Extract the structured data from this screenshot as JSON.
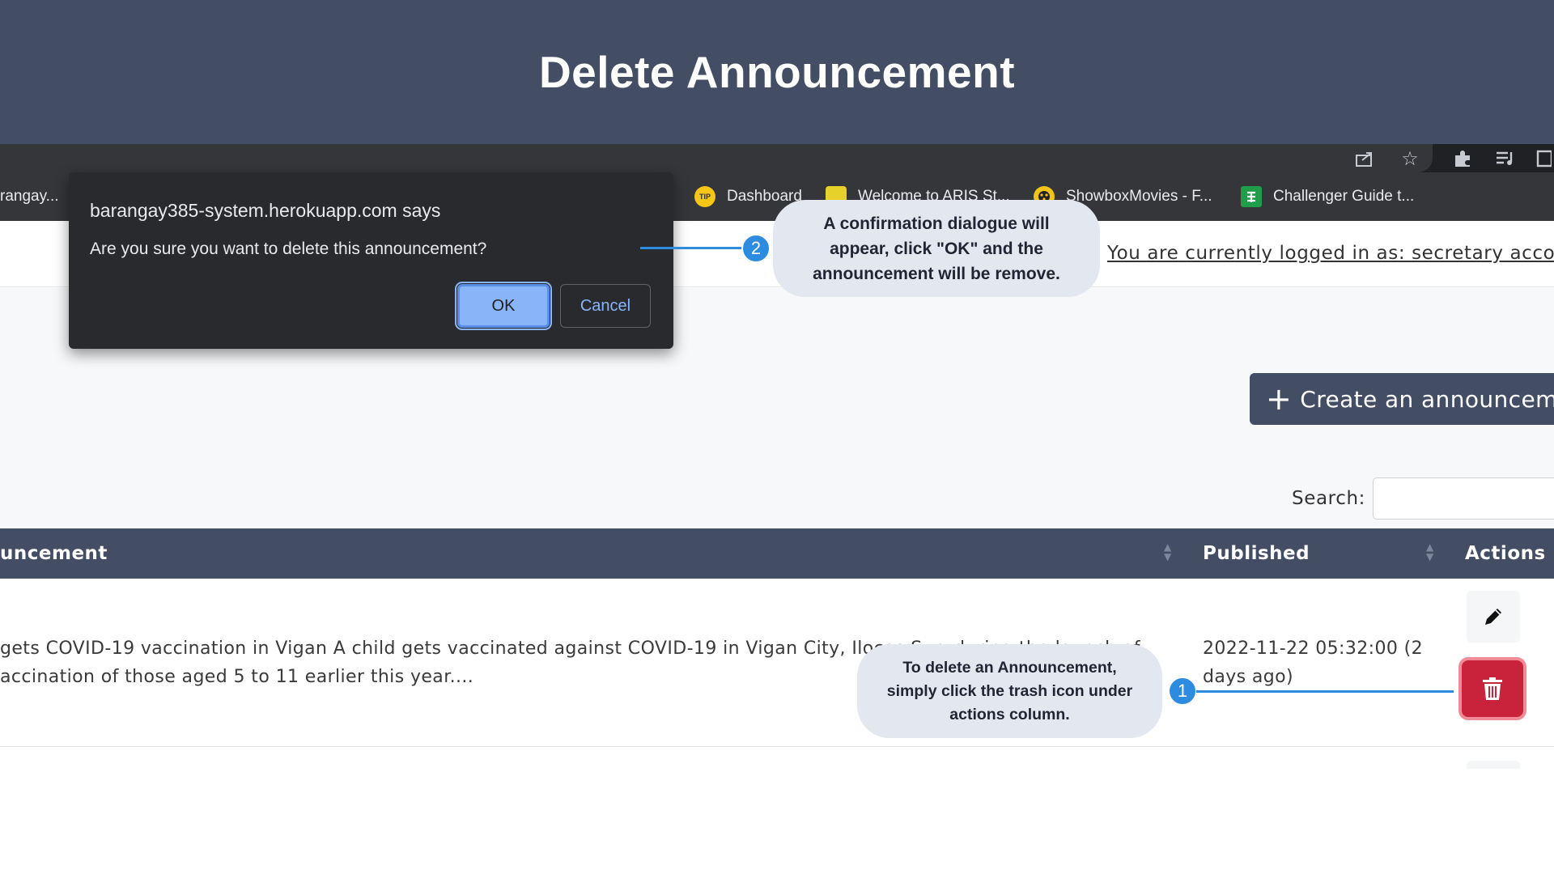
{
  "banner": {
    "title": "Delete Announcement"
  },
  "bookmarks": {
    "items": [
      {
        "label": "rangay...",
        "icon": "bookmark-icon"
      },
      {
        "label": "Dashboard",
        "icon": "tip-icon",
        "icon_text": "TIP"
      },
      {
        "label": "Welcome to ARIS St...",
        "icon": "aris-icon"
      },
      {
        "label": "ShowboxMovies - F...",
        "icon": "showbox-icon"
      },
      {
        "label": "Challenger Guide t...",
        "icon": "sheets-icon"
      }
    ]
  },
  "app": {
    "logged_in": "You are currently logged in as: secretary account",
    "create_button": "Create an announcement",
    "search_label": "Search:"
  },
  "table": {
    "headers": [
      "uncement",
      "Published",
      "Actions"
    ],
    "row": {
      "announcement_line1": " gets COVID-19 vaccination in Vigan A child gets vaccinated against COVID-19 in Vigan City, Ilocos Sur, during the launch of",
      "announcement_line2": "accination of those aged 5 to 11 earlier this year....",
      "published_line1": "2022-11-22 05:32:00 (2",
      "published_line2": "days ago)"
    }
  },
  "dialog": {
    "title": "barangay385-system.herokuapp.com says",
    "message": "Are you sure you want to delete this announcement?",
    "ok": "OK",
    "cancel": "Cancel"
  },
  "callouts": {
    "step1": {
      "number": "1",
      "text": "To delete an Announcement, simply click the trash icon under actions column."
    },
    "step2": {
      "number": "2",
      "text": "A confirmation dialogue will appear, click \"OK\" and the announcement will be remove."
    }
  },
  "colors": {
    "banner": "#434e65",
    "accent": "#2d8ce0",
    "delete": "#c8233a",
    "dialog": "#292a2d"
  }
}
